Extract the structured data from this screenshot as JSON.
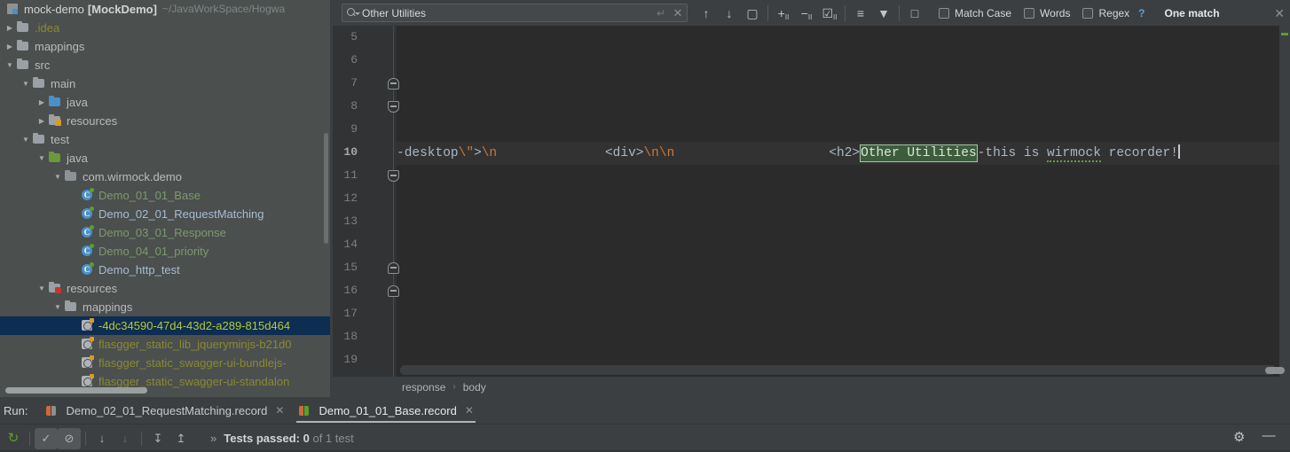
{
  "project": {
    "root": {
      "name": "mock-demo",
      "module": "[MockDemo]",
      "path": "~/JavaWorkSpace/Hogwa"
    },
    "tree": [
      {
        "label": ".idea",
        "indent": 1,
        "arrow": "right",
        "icon": "folder",
        "style": "yellow-dim"
      },
      {
        "label": "mappings",
        "indent": 1,
        "arrow": "right",
        "icon": "folder",
        "style": ""
      },
      {
        "label": "src",
        "indent": 1,
        "arrow": "down",
        "icon": "folder",
        "style": ""
      },
      {
        "label": "main",
        "indent": 2,
        "arrow": "down",
        "icon": "folder",
        "style": ""
      },
      {
        "label": "java",
        "indent": 3,
        "arrow": "right",
        "icon": "folder-blue",
        "style": ""
      },
      {
        "label": "resources",
        "indent": 3,
        "arrow": "right",
        "icon": "folder-res",
        "style": ""
      },
      {
        "label": "test",
        "indent": 2,
        "arrow": "down",
        "icon": "folder",
        "style": ""
      },
      {
        "label": "java",
        "indent": 3,
        "arrow": "down",
        "icon": "folder-green",
        "style": ""
      },
      {
        "label": "com.wirmock.demo",
        "indent": 4,
        "arrow": "down",
        "icon": "folder-pkg",
        "style": ""
      },
      {
        "label": "Demo_01_01_Base",
        "indent": 5,
        "arrow": "none",
        "icon": "class",
        "style": "greenish"
      },
      {
        "label": "Demo_02_01_RequestMatching",
        "indent": 5,
        "arrow": "none",
        "icon": "class",
        "style": "blueish"
      },
      {
        "label": "Demo_03_01_Response",
        "indent": 5,
        "arrow": "none",
        "icon": "class",
        "style": "greenish"
      },
      {
        "label": "Demo_04_01_priority",
        "indent": 5,
        "arrow": "none",
        "icon": "class",
        "style": "greenish"
      },
      {
        "label": "Demo_http_test",
        "indent": 5,
        "arrow": "none",
        "icon": "class",
        "style": "blueish"
      },
      {
        "label": "resources",
        "indent": 3,
        "arrow": "down",
        "icon": "folder-resgreen",
        "style": ""
      },
      {
        "label": "mappings",
        "indent": 4,
        "arrow": "down",
        "icon": "folder",
        "style": ""
      },
      {
        "label": "-4dc34590-47d4-43d2-a289-815d464",
        "indent": 5,
        "arrow": "none",
        "icon": "json",
        "style": "sel",
        "selected": true
      },
      {
        "label": "flasgger_static_lib_jqueryminjs-b21d0",
        "indent": 5,
        "arrow": "none",
        "icon": "json",
        "style": "yellow-dim"
      },
      {
        "label": "flasgger_static_swagger-ui-bundlejs-",
        "indent": 5,
        "arrow": "none",
        "icon": "json",
        "style": "yellow-dim"
      },
      {
        "label": "flasgger_static_swagger-ui-standalon",
        "indent": 5,
        "arrow": "none",
        "icon": "json",
        "style": "yellow-dim"
      }
    ]
  },
  "search": {
    "value": "Other Utilities",
    "placeholder": "Search",
    "return_glyph": "↵",
    "clear_glyph": "✕",
    "prev_glyph": "↑",
    "next_glyph": "↓",
    "select_all_glyph": "▢",
    "add_line_glyph": "+",
    "remove_line_glyph": "−",
    "select_lines_glyph": "☑",
    "filter_lines_glyph": "≡",
    "filter_glyph": "▼",
    "preview_glyph": "□",
    "options": [
      {
        "label": "Match Case",
        "checked": false
      },
      {
        "label": "Words",
        "checked": false
      },
      {
        "label": "Regex",
        "checked": false
      }
    ],
    "help": "?",
    "status": "One match",
    "close_glyph": "✕"
  },
  "editor": {
    "lines": [
      5,
      6,
      7,
      8,
      9,
      10,
      11,
      12,
      13,
      14,
      15,
      16,
      17,
      18,
      19
    ],
    "current_line": 10,
    "fold_marks": [
      {
        "line": 7,
        "dir": "up"
      },
      {
        "line": 8,
        "dir": "down"
      },
      {
        "line": 11,
        "dir": "down"
      },
      {
        "line": 15,
        "dir": "up"
      },
      {
        "line": 16,
        "dir": "up"
      }
    ],
    "code": {
      "seg1": "-desktop",
      "seg2": "\\\"",
      "seg3": ">",
      "seg4": "\\n",
      "gap1": "              ",
      "seg5": "<div>",
      "seg6": "\\n\\n",
      "gap2": "                    ",
      "seg7": "<h2>",
      "match": "Other Utilities",
      "seg8": "-this is ",
      "typo": "wirmock",
      "seg9": " recorder!"
    }
  },
  "breadcrumb": {
    "items": [
      "response",
      "body"
    ],
    "separator": "›"
  },
  "run": {
    "label": "Run:",
    "tabs": [
      {
        "title": "Demo_02_01_RequestMatching.record",
        "active": false,
        "close": "✕"
      },
      {
        "title": "Demo_01_01_Base.record",
        "active": true,
        "close": "✕"
      }
    ],
    "toolbar": [
      {
        "name": "rerun-button",
        "glyph": "↻",
        "state": "rerun"
      },
      {
        "name": "show-passed-toggle",
        "glyph": "✓",
        "state": "on"
      },
      {
        "name": "show-ignored-toggle",
        "glyph": "⊘",
        "state": "on"
      },
      {
        "name": "sort-alphabetically-button",
        "glyph": "↓",
        "state": ""
      },
      {
        "name": "sort-by-duration-button",
        "glyph": "↓",
        "state": "dim"
      },
      {
        "name": "expand-all-button",
        "glyph": "↧",
        "state": ""
      },
      {
        "name": "collapse-all-button",
        "glyph": "↥",
        "state": ""
      }
    ],
    "status": {
      "chevron": "»",
      "prefix": "Tests passed:",
      "count": "0",
      "suffix": "of 1 test"
    },
    "gear_glyph": "⚙",
    "minimize_glyph": "—"
  }
}
